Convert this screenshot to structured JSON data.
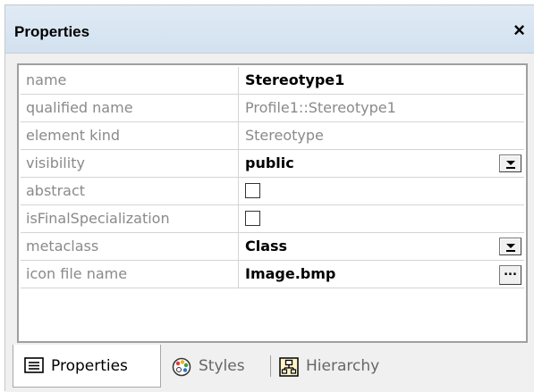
{
  "window": {
    "title": "Properties",
    "close_glyph": "×"
  },
  "properties": [
    {
      "name": "name",
      "value": "Stereotype1",
      "style": "bold",
      "editor": "text"
    },
    {
      "name": "qualified name",
      "value": "Profile1::Stereotype1",
      "style": "grey",
      "editor": "readonly"
    },
    {
      "name": "element kind",
      "value": "Stereotype",
      "style": "grey",
      "editor": "readonly"
    },
    {
      "name": "visibility",
      "value": "public",
      "style": "bold",
      "editor": "dropdown"
    },
    {
      "name": "abstract",
      "value": false,
      "editor": "checkbox"
    },
    {
      "name": "isFinalSpecialization",
      "value": false,
      "editor": "checkbox"
    },
    {
      "name": "metaclass",
      "value": "Class",
      "style": "bold",
      "editor": "dropdown"
    },
    {
      "name": "icon file name",
      "value": "Image.bmp",
      "style": "bold",
      "editor": "browse",
      "browse_label": "..."
    }
  ],
  "tabs": [
    {
      "label": "Properties",
      "icon": "properties-icon",
      "active": true
    },
    {
      "label": "Styles",
      "icon": "styles-palette-icon",
      "active": false
    },
    {
      "label": "Hierarchy",
      "icon": "hierarchy-icon",
      "active": false
    }
  ],
  "colors": {
    "titlebar": "#d3e1ef",
    "grid_line": "#d4d4d4",
    "label_text": "#8a8a8a"
  }
}
